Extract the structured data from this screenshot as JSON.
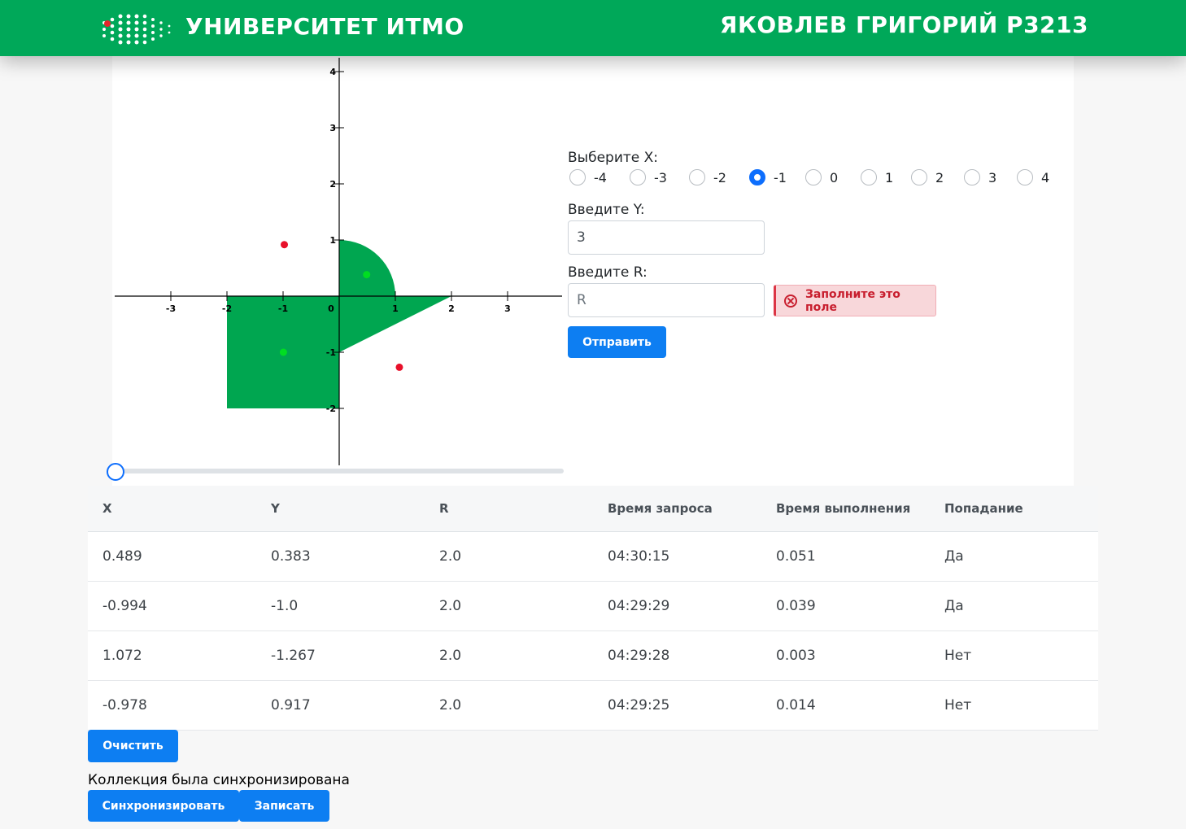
{
  "header": {
    "university": "УНИВЕРСИТЕТ ИТМО",
    "student": "ЯКОВЛЕВ ГРИГОРИЙ P3213"
  },
  "graph": {
    "x_ticks": [
      "-3",
      "-2",
      "-1",
      "0",
      "1",
      "2",
      "3"
    ],
    "y_ticks": [
      "4",
      "3",
      "2",
      "1",
      "-1",
      "-2"
    ],
    "area_color": "#00a650",
    "points": [
      {
        "x": 0.489,
        "y": 0.383,
        "hit": true
      },
      {
        "x": -0.994,
        "y": -1.0,
        "hit": true
      },
      {
        "x": 1.072,
        "y": -1.267,
        "hit": false
      },
      {
        "x": -0.978,
        "y": 0.917,
        "hit": false
      }
    ],
    "slider_value": 0
  },
  "form": {
    "x_label": "Выберите X:",
    "x_options": [
      "-4",
      "-3",
      "-2",
      "-1",
      "0",
      "1",
      "2",
      "3",
      "4"
    ],
    "x_selected": "-1",
    "y_label": "Введите Y:",
    "y_value": "3",
    "r_label": "Введите R:",
    "r_placeholder": "R",
    "r_error": "Заполните это поле",
    "submit": "Отправить"
  },
  "table": {
    "headers": [
      "X",
      "Y",
      "R",
      "Время запроса",
      "Время выполнения",
      "Попадание"
    ],
    "rows": [
      [
        "0.489",
        "0.383",
        "2.0",
        "04:30:15",
        "0.051",
        "Да"
      ],
      [
        "-0.994",
        "-1.0",
        "2.0",
        "04:29:29",
        "0.039",
        "Да"
      ],
      [
        "1.072",
        "-1.267",
        "2.0",
        "04:29:28",
        "0.003",
        "Нет"
      ],
      [
        "-0.978",
        "0.917",
        "2.0",
        "04:29:25",
        "0.014",
        "Нет"
      ]
    ]
  },
  "actions": {
    "clear": "Очистить",
    "status": "Коллекция была синхронизирована",
    "sync": "Синхронизировать",
    "write": "Записать"
  },
  "colors": {
    "brand_green": "#00a859",
    "primary_blue": "#0d7ef2",
    "hit_point": "#00dd22",
    "miss_point": "#e8102a"
  }
}
